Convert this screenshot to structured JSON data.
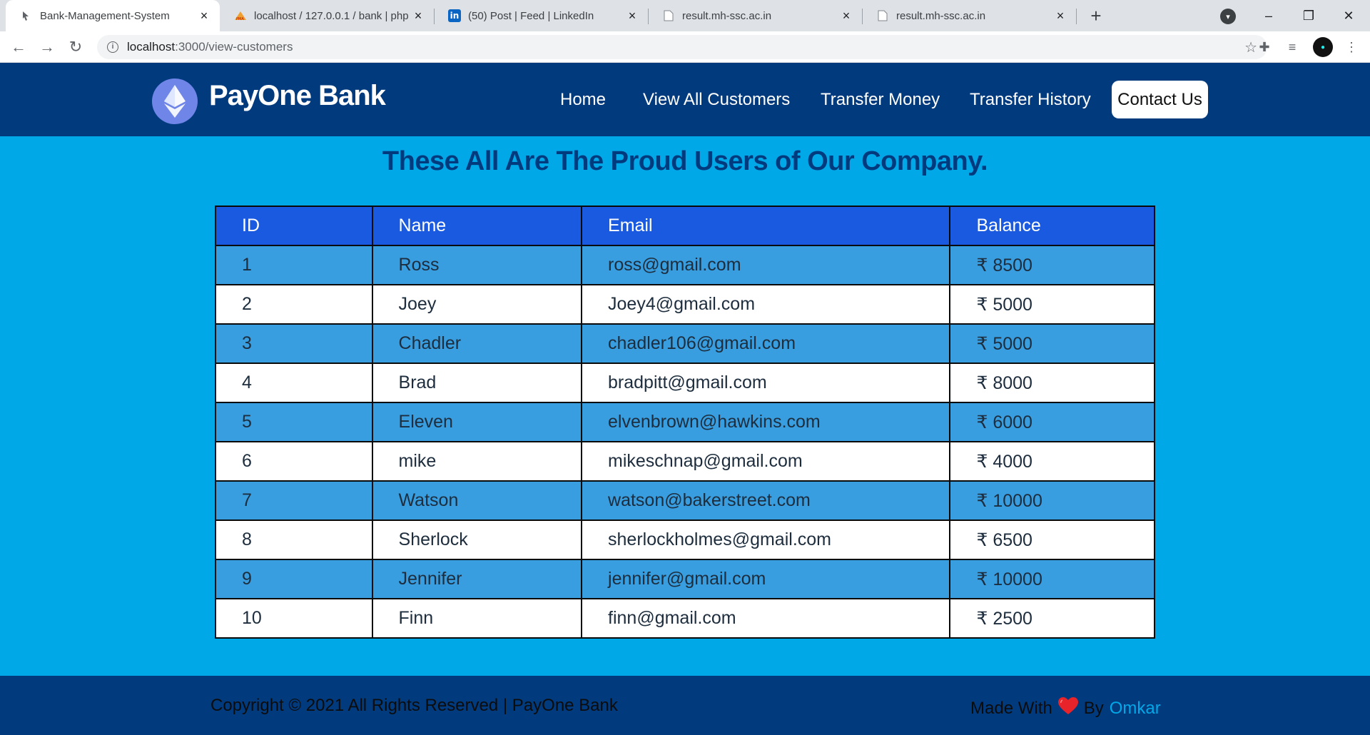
{
  "browser": {
    "tabs": [
      {
        "title": "Bank-Management-System",
        "active": true
      },
      {
        "title": "localhost / 127.0.0.1 / bank | php",
        "active": false
      },
      {
        "title": "(50) Post | Feed | LinkedIn",
        "active": false
      },
      {
        "title": "result.mh-ssc.ac.in",
        "active": false
      },
      {
        "title": "result.mh-ssc.ac.in",
        "active": false
      }
    ],
    "favicons": {
      "tab1": "PMA",
      "tab2": "in"
    },
    "url_host": "localhost",
    "url_path": ":3000/view-customers"
  },
  "header": {
    "brand": "PayOne Bank",
    "nav": {
      "home": "Home",
      "customers": "View All Customers",
      "transfer": "Transfer Money",
      "history": "Transfer History",
      "contact": "Contact Us"
    }
  },
  "main": {
    "title": "These All Are The Proud Users of Our Company.",
    "table": {
      "headers": {
        "id": "ID",
        "name": "Name",
        "email": "Email",
        "balance": "Balance"
      },
      "rows": [
        {
          "id": "1",
          "name": "Ross",
          "email": "ross@gmail.com",
          "balance": "₹ 8500"
        },
        {
          "id": "2",
          "name": "Joey",
          "email": "Joey4@gmail.com",
          "balance": "₹ 5000"
        },
        {
          "id": "3",
          "name": "Chadler",
          "email": "chadler106@gmail.com",
          "balance": "₹ 5000"
        },
        {
          "id": "4",
          "name": "Brad",
          "email": "bradpitt@gmail.com",
          "balance": "₹ 8000"
        },
        {
          "id": "5",
          "name": "Eleven",
          "email": "elvenbrown@hawkins.com",
          "balance": "₹ 6000"
        },
        {
          "id": "6",
          "name": "mike",
          "email": "mikeschnap@gmail.com",
          "balance": "₹ 4000"
        },
        {
          "id": "7",
          "name": "Watson",
          "email": "watson@bakerstreet.com",
          "balance": "₹ 10000"
        },
        {
          "id": "8",
          "name": "Sherlock",
          "email": "sherlockholmes@gmail.com",
          "balance": "₹ 6500"
        },
        {
          "id": "9",
          "name": "Jennifer",
          "email": "jennifer@gmail.com",
          "balance": "₹ 10000"
        },
        {
          "id": "10",
          "name": "Finn",
          "email": "finn@gmail.com",
          "balance": "₹ 2500"
        }
      ]
    }
  },
  "footer": {
    "copyright": "Copyright © 2021 All Rights Reserved | PayOne Bank",
    "made_with": "Made With",
    "by": "By",
    "author": "Omkar"
  },
  "colors": {
    "page_bg": "#00a8e8",
    "header_bg": "#023a7e",
    "table_header": "#1a5ae0",
    "row_odd": "#389ee0",
    "row_even": "#ffffff",
    "author_link": "#00a8e8"
  }
}
